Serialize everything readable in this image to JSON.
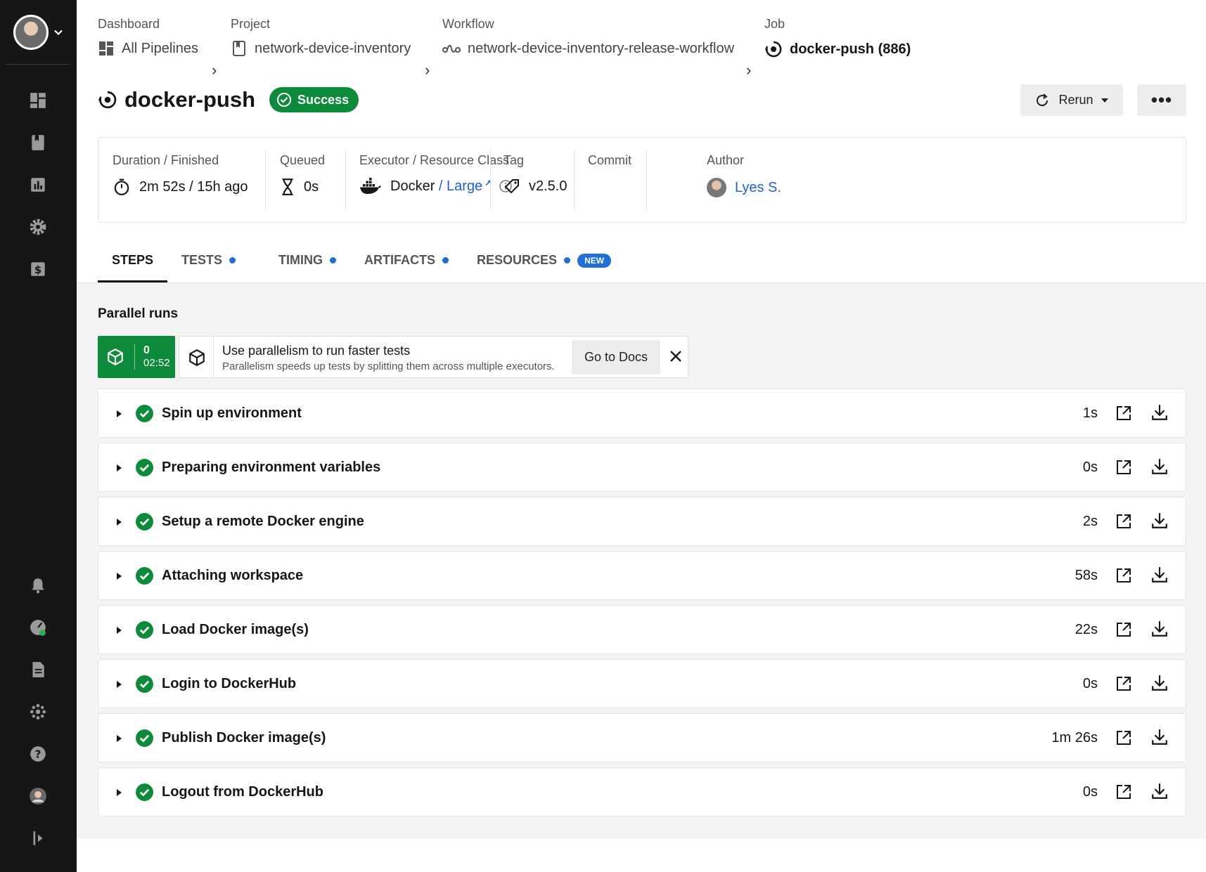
{
  "breadcrumbs": {
    "dashboard": {
      "label": "Dashboard",
      "value": "All Pipelines"
    },
    "project": {
      "label": "Project",
      "value": "network-device-inventory"
    },
    "workflow": {
      "label": "Workflow",
      "value": "network-device-inventory-release-workflow"
    },
    "job": {
      "label": "Job",
      "value": "docker-push (886)"
    }
  },
  "job": {
    "title": "docker-push",
    "status": "Success",
    "status_color": "#0d8a3a"
  },
  "actions": {
    "rerun_label": "Rerun",
    "more_label": "•••"
  },
  "info": {
    "duration": {
      "label": "Duration / Finished",
      "value": "2m 52s / 15h ago"
    },
    "queued": {
      "label": "Queued",
      "value": "0s"
    },
    "executor": {
      "label": "Executor / Resource Class",
      "executor": "Docker",
      "separator": " / ",
      "resource_class": "Large",
      "link_mark": "↗"
    },
    "tag": {
      "label": "Tag",
      "value": "v2.5.0"
    },
    "commit": {
      "label": "Commit"
    },
    "author": {
      "label": "Author",
      "value": "Lyes S."
    }
  },
  "tabs": [
    {
      "label": "STEPS"
    },
    {
      "label": "TESTS"
    },
    {
      "label": "TIMING"
    },
    {
      "label": "ARTIFACTS"
    },
    {
      "label": "RESOURCES",
      "badge": "NEW"
    }
  ],
  "parallel": {
    "title": "Parallel runs",
    "run_index": "0",
    "run_time": "02:52",
    "banner_title": "Use parallelism to run faster tests",
    "banner_subtitle": "Parallelism speeds up tests by splitting them across multiple executors.",
    "docs_button": "Go to Docs"
  },
  "steps": [
    {
      "name": "Spin up environment",
      "duration": "1s"
    },
    {
      "name": "Preparing environment variables",
      "duration": "0s"
    },
    {
      "name": "Setup a remote Docker engine",
      "duration": "2s"
    },
    {
      "name": "Attaching workspace",
      "duration": "58s"
    },
    {
      "name": "Load Docker image(s)",
      "duration": "22s"
    },
    {
      "name": "Login to DockerHub",
      "duration": "0s"
    },
    {
      "name": "Publish Docker image(s)",
      "duration": "1m 26s"
    },
    {
      "name": "Logout from DockerHub",
      "duration": "0s"
    }
  ],
  "colors": {
    "sidebar": "#161616",
    "success": "#0d8a3a",
    "link": "#1f5fd6",
    "accent_dot": "#1f6fd6"
  }
}
